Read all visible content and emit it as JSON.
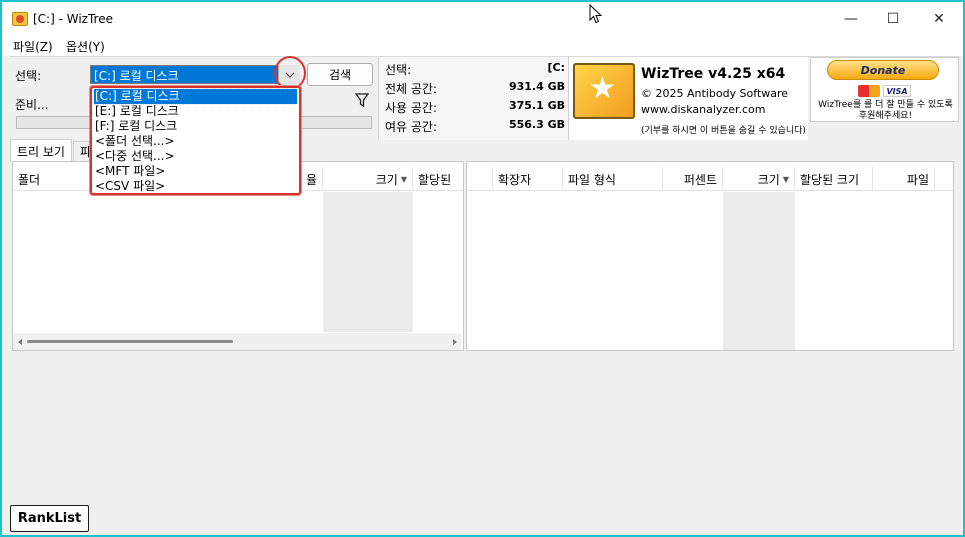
{
  "window": {
    "title": "[C:]  - WizTree",
    "minimize_glyph": "—",
    "maximize_glyph": "☐",
    "close_glyph": "✕"
  },
  "menu": {
    "file": "파일(Z)",
    "options": "옵션(Y)"
  },
  "scan": {
    "select_label": "선택:",
    "selected_drive": "[C:] 로컬 디스크",
    "search_button": "검색",
    "status": "준비...",
    "progress": 0
  },
  "drive_stats": {
    "select_label": "선택:",
    "select_value": "[C:",
    "total_label": "전체 공간:",
    "total_value": "931.4 GB",
    "used_label": "사용 공간:",
    "used_value": "375.1 GB",
    "free_label": "여유 공간:",
    "free_value": "556.3 GB"
  },
  "brand": {
    "title": "WizTree v4.25 x64",
    "copyright": "© 2025 Antibody Software",
    "website": "www.diskanalyzer.com",
    "note": "(기부를 하시면 이 버튼을 숨길 수 있습니다)"
  },
  "donate": {
    "button": "Donate",
    "card_visa": "VISA",
    "note": "WizTree를 를 더 잘 만들 수 있도록 후원해주세요!"
  },
  "tabs": [
    {
      "label": "트리 보기"
    },
    {
      "label": "파"
    }
  ],
  "left_table": {
    "columns": [
      "폴더",
      "율",
      "크기",
      "할당된"
    ]
  },
  "right_table": {
    "columns": [
      "확장자",
      "파일 형식",
      "퍼센트",
      "크기",
      "할당된 크기",
      "파일"
    ]
  },
  "dropdown": {
    "items": [
      "[C:] 로컬 디스크",
      "[E:] 로컬 디스크",
      "[F:] 로컬 디스크",
      "<폴더 선택...>",
      "<다중 선택...>",
      "<MFT 파일>",
      "<CSV 파일>"
    ]
  },
  "overlay": {
    "ranklist": "RankList"
  },
  "colors": {
    "frame_border": "#1fc1c8",
    "highlight_red": "#d8322d",
    "selection_blue": "#0078d7"
  }
}
